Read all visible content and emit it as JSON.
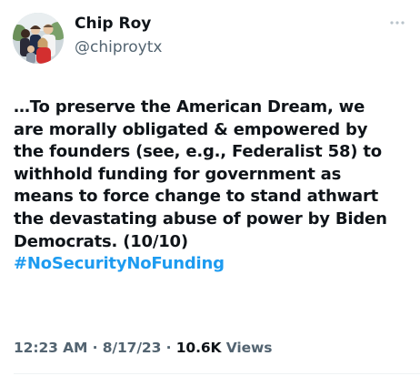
{
  "author": {
    "display_name": "Chip Roy",
    "handle": "@chiproytx",
    "avatar_icon": "profile-photo-avatar"
  },
  "tweet": {
    "lines": [
      "…To preserve the American Dream, we",
      "are morally obligated & empowered by",
      "the founders (see, e.g., Federalist 58) to",
      "withhold funding for government as",
      "means to force change to stand athwart",
      "the devastating abuse of power by Biden",
      "Democrats. (10/10)"
    ],
    "hashtag": "#NoSecurityNoFunding"
  },
  "meta": {
    "time": "12:23 AM",
    "separator_1": " · ",
    "date": "8/17/23",
    "separator_2": " · ",
    "views_count": "10.6K",
    "views_label": " Views"
  },
  "colors": {
    "text": "#0f1419",
    "secondary": "#536471",
    "link": "#1d9bf0"
  },
  "icons": {
    "more": "more-options-icon"
  }
}
